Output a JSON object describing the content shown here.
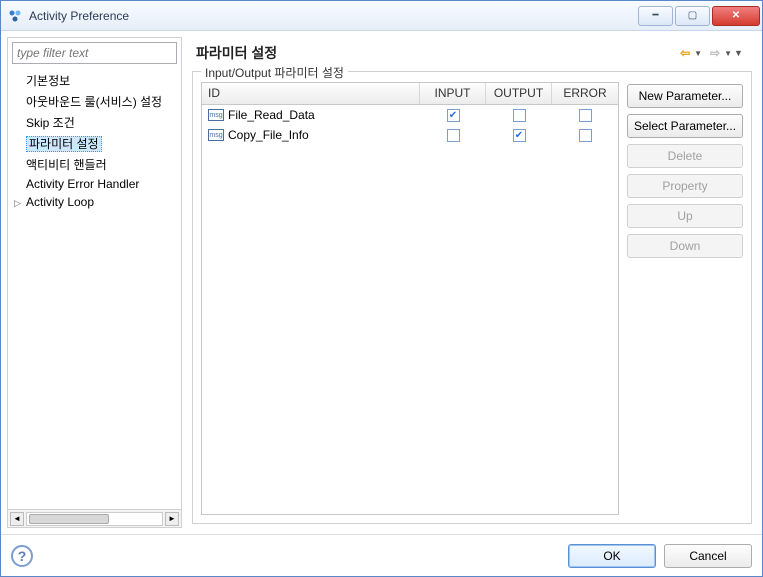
{
  "window": {
    "title": "Activity Preference"
  },
  "filter": {
    "placeholder": "type filter text"
  },
  "tree": {
    "items": [
      {
        "label": "기본정보"
      },
      {
        "label": "아웃바운드 룰(서비스) 설정"
      },
      {
        "label": "Skip 조건"
      },
      {
        "label": "파라미터 설정",
        "selected": true
      },
      {
        "label": "액티비티 핸들러"
      },
      {
        "label": "Activity Error Handler"
      },
      {
        "label": "Activity Loop",
        "expandable": true
      }
    ]
  },
  "page": {
    "title": "파라미터 설정"
  },
  "group": {
    "label": "Input/Output 파라미터 설정"
  },
  "table": {
    "headers": {
      "id": "ID",
      "input": "INPUT",
      "output": "OUTPUT",
      "error": "ERROR"
    },
    "rows": [
      {
        "id": "File_Read_Data",
        "input": true,
        "output": false,
        "error": false
      },
      {
        "id": "Copy_File_Info",
        "input": false,
        "output": true,
        "error": false
      }
    ]
  },
  "buttons": {
    "new": "New Parameter...",
    "select": "Select Parameter...",
    "delete": "Delete",
    "property": "Property",
    "up": "Up",
    "down": "Down"
  },
  "footer": {
    "ok": "OK",
    "cancel": "Cancel"
  },
  "icons": {
    "msg": "msg",
    "help": "?"
  }
}
